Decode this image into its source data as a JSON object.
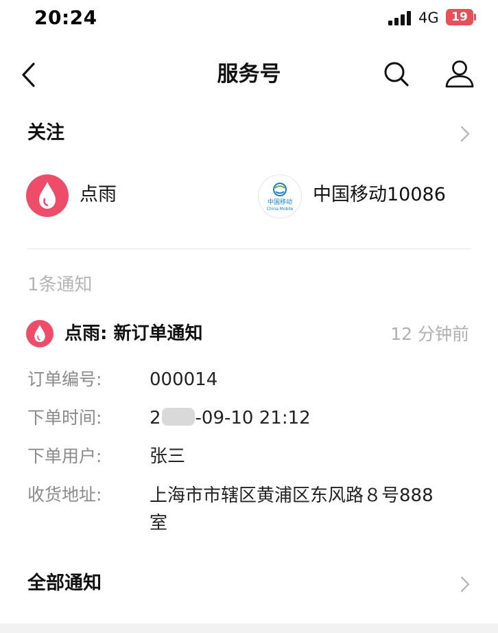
{
  "status_bar": {
    "time": "20:24",
    "network": "4G",
    "battery": "19"
  },
  "nav": {
    "title": "服务号",
    "back_icon": "chevron-left-icon",
    "search_icon": "search-icon",
    "profile_icon": "person-icon"
  },
  "follow": {
    "title": "关注",
    "accounts": [
      {
        "name": "点雨",
        "icon": "dianyu-drop-icon"
      },
      {
        "name": "中国移动10086",
        "icon": "china-mobile-logo",
        "logo_text": "中国移动",
        "logo_subtext": "China Mobile"
      }
    ]
  },
  "notifications": {
    "count_label": "1条通知",
    "item": {
      "title": "点雨: 新订单通知",
      "time": "12 分钟前",
      "fields": [
        {
          "label": "订单编号:",
          "value": "000014"
        },
        {
          "label": "下单时间:",
          "value_prefix": "2",
          "value_suffix": "-09-10 21:12"
        },
        {
          "label": "下单用户:",
          "value": "张三"
        },
        {
          "label": "收货地址:",
          "value": "上海市市辖区黄浦区东风路８号888室"
        }
      ]
    }
  },
  "all_notifications": {
    "title": "全部通知"
  },
  "colors": {
    "accent": "#ef4c6a",
    "battery": "#e65058",
    "muted_text": "#8a8a8a",
    "light_text": "#b5b5b5"
  }
}
